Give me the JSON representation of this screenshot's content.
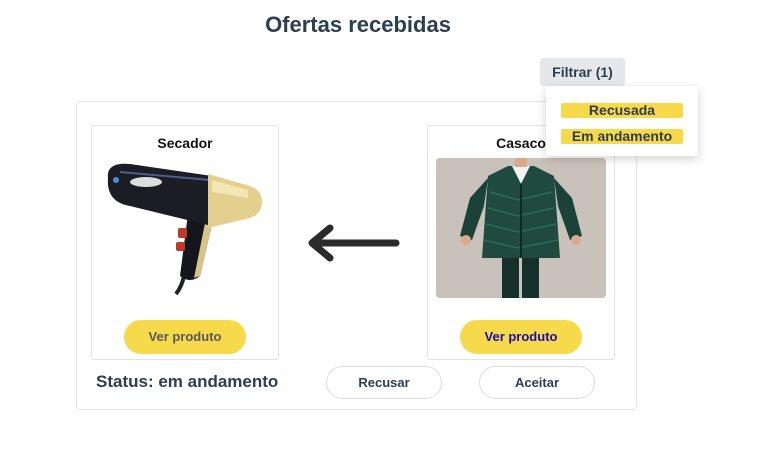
{
  "page": {
    "title": "Ofertas recebidas"
  },
  "filter": {
    "label": "Filtrar (1)",
    "options": [
      "Recusada",
      "Em andamento"
    ]
  },
  "offer": {
    "offered_product": {
      "name": "Secador",
      "button_label": "Ver produto"
    },
    "requested_product": {
      "name": "Casaco",
      "button_label": "Ver produto"
    },
    "status_text": "Status: em andamento",
    "reject_label": "Recusar",
    "accept_label": "Aceitar"
  },
  "colors": {
    "accent_yellow": "#f7d94c",
    "title_text": "#2c3e50",
    "visited_link": "#1a0dab"
  },
  "icons": {
    "arrow": "arrow-left-icon"
  }
}
